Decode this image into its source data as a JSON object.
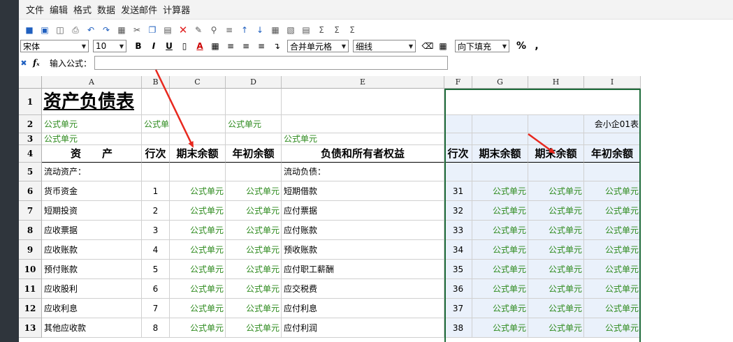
{
  "menu": [
    "文件",
    "编辑",
    "格式",
    "数据",
    "发送邮件",
    "计算器"
  ],
  "toolbar": {
    "font_name": "宋体",
    "font_size": "10",
    "bold": "B",
    "italic": "I",
    "underline": "U",
    "merge": "合并单元格",
    "border": "细线",
    "fill": "向下填充",
    "percent": "%",
    "comma": ","
  },
  "formula": {
    "label": "输入公式：",
    "value": ""
  },
  "columns": [
    {
      "id": "A",
      "label": "A"
    },
    {
      "id": "B",
      "label": "B"
    },
    {
      "id": "C",
      "label": "C"
    },
    {
      "id": "D",
      "label": "D"
    },
    {
      "id": "E",
      "label": "E"
    },
    {
      "id": "F",
      "label": "F"
    },
    {
      "id": "G",
      "label": "G"
    },
    {
      "id": "H",
      "label": "H"
    },
    {
      "id": "I",
      "label": "I"
    }
  ],
  "rows": [
    "1",
    "2",
    "3",
    "4",
    "5",
    "6",
    "7",
    "8",
    "9",
    "10",
    "11",
    "12",
    "13"
  ],
  "title": "资产负债表",
  "formula_cell": "公式单元",
  "formula_cell_cut": "公式单元",
  "form_code": "会小企01表",
  "headers": {
    "assets": "资　　产",
    "line_no": "行次",
    "end_balance": "期末余额",
    "begin_balance": "年初余额",
    "liabilities": "负债和所有者权益"
  },
  "current_assets": "流动资产：",
  "current_liabilities": "流动负债：",
  "asset_rows": [
    {
      "name": "货币资金",
      "line": "1"
    },
    {
      "name": "短期投资",
      "line": "2"
    },
    {
      "name": "应收票据",
      "line": "3"
    },
    {
      "name": "应收账款",
      "line": "4"
    },
    {
      "name": "预付账款",
      "line": "5"
    },
    {
      "name": "应收股利",
      "line": "6"
    },
    {
      "name": "应收利息",
      "line": "7"
    },
    {
      "name": "其他应收款",
      "line": "8"
    }
  ],
  "liability_rows": [
    {
      "name": "短期借款",
      "line": "31"
    },
    {
      "name": "应付票据",
      "line": "32"
    },
    {
      "name": "应付账款",
      "line": "33"
    },
    {
      "name": "预收账款",
      "line": "34"
    },
    {
      "name": "应付职工薪酬",
      "line": "35"
    },
    {
      "name": "应交税费",
      "line": "36"
    },
    {
      "name": "应付利息",
      "line": "37"
    },
    {
      "name": "应付利润",
      "line": "38"
    }
  ],
  "colors": {
    "formula_green": "#2e8b1e",
    "selection_border": "#1e6b3a",
    "arrow_red": "#e8281e"
  }
}
